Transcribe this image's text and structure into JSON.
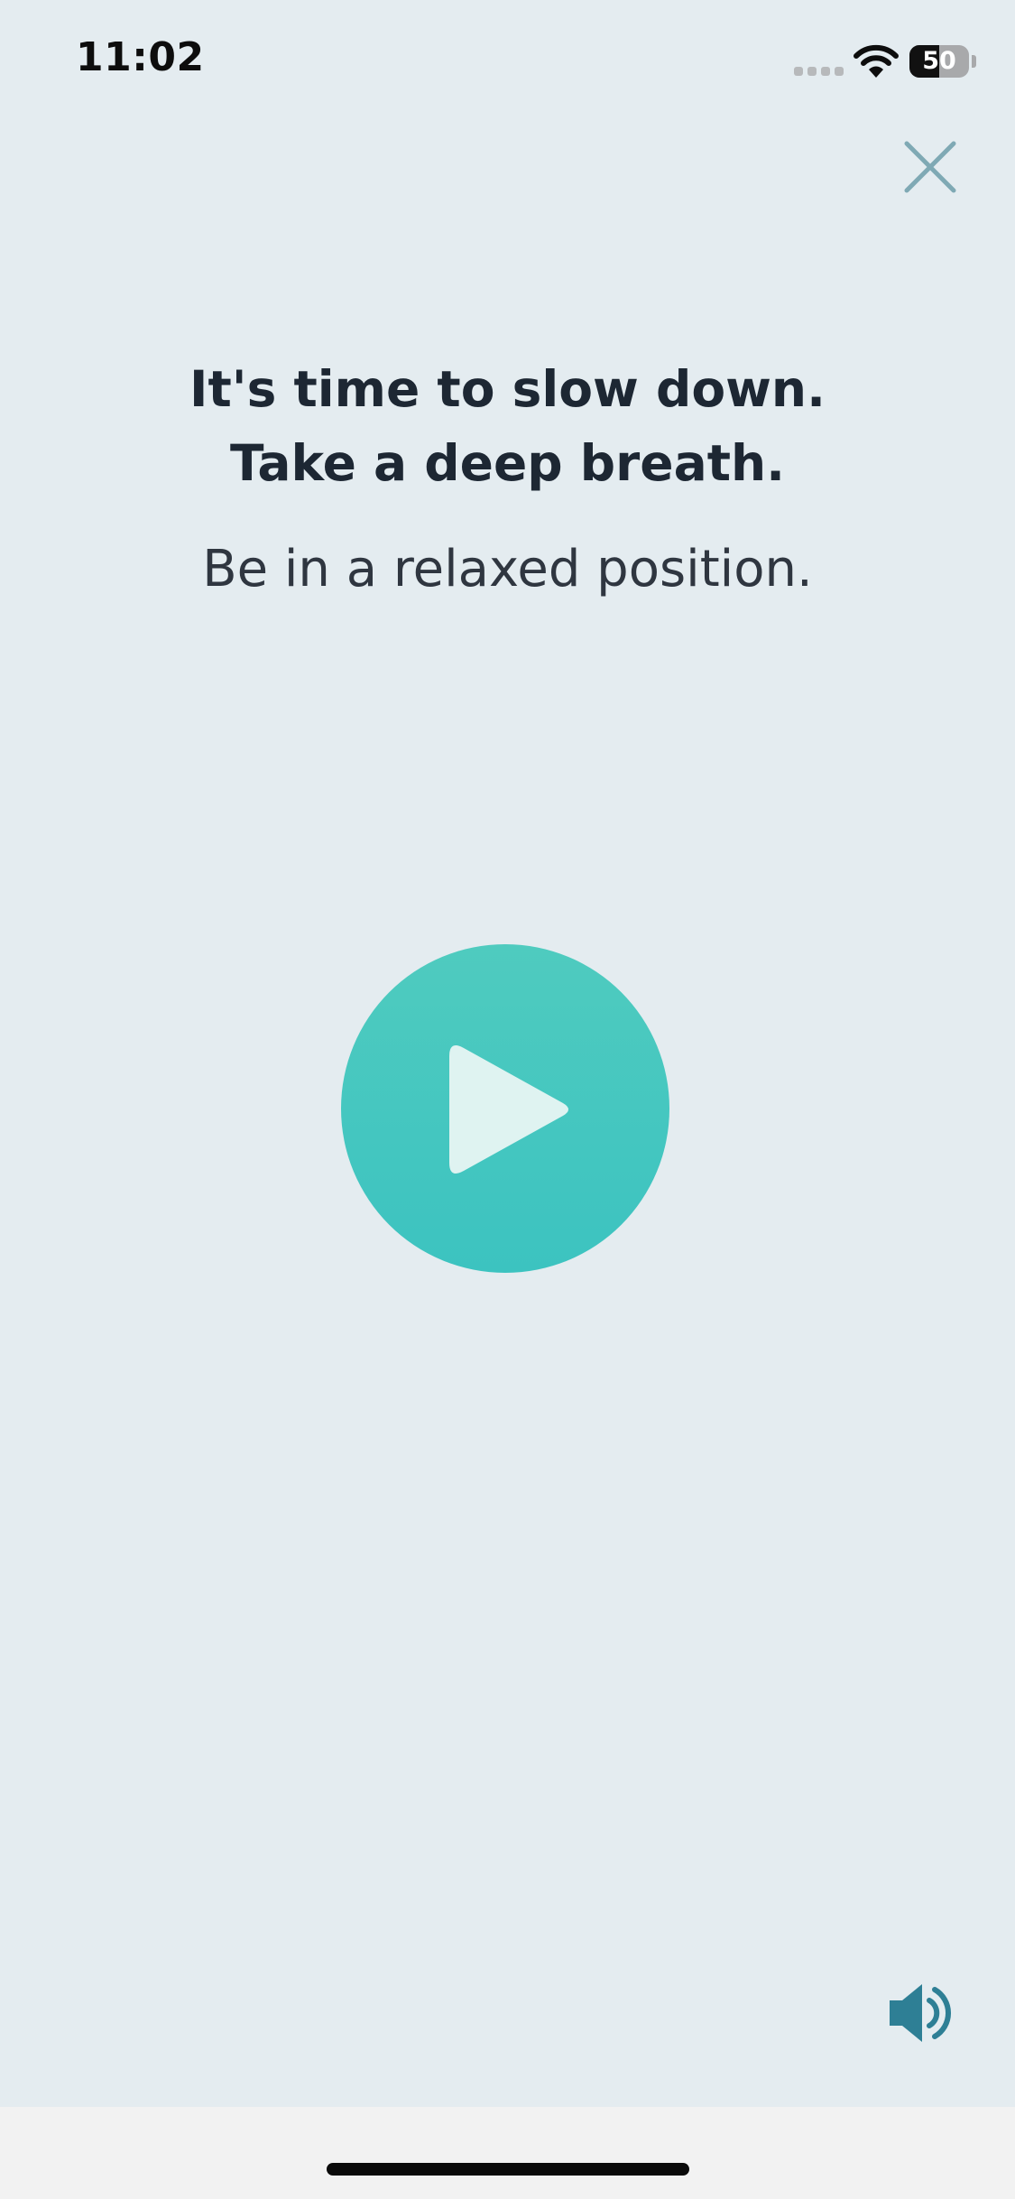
{
  "status_bar": {
    "time": "11:02",
    "signal_icon": "cellular-signal-icon",
    "wifi_icon": "wifi-icon",
    "battery_icon": "battery-icon",
    "battery_level": "50",
    "battery_fraction": 0.5
  },
  "header": {
    "close_icon": "close-icon"
  },
  "prompt": {
    "line1": "It's time to slow down.",
    "line2": "Take a deep breath.",
    "instruction": "Be in a relaxed position."
  },
  "player": {
    "play_icon": "play-icon"
  },
  "footer": {
    "sound_icon": "speaker-icon"
  },
  "colors": {
    "background": "#e4ecf0",
    "accent": "#45c6bf",
    "close_icon": "#7fa9b4",
    "sound_icon": "#2e7f95",
    "headline_text": "#1d2733"
  }
}
